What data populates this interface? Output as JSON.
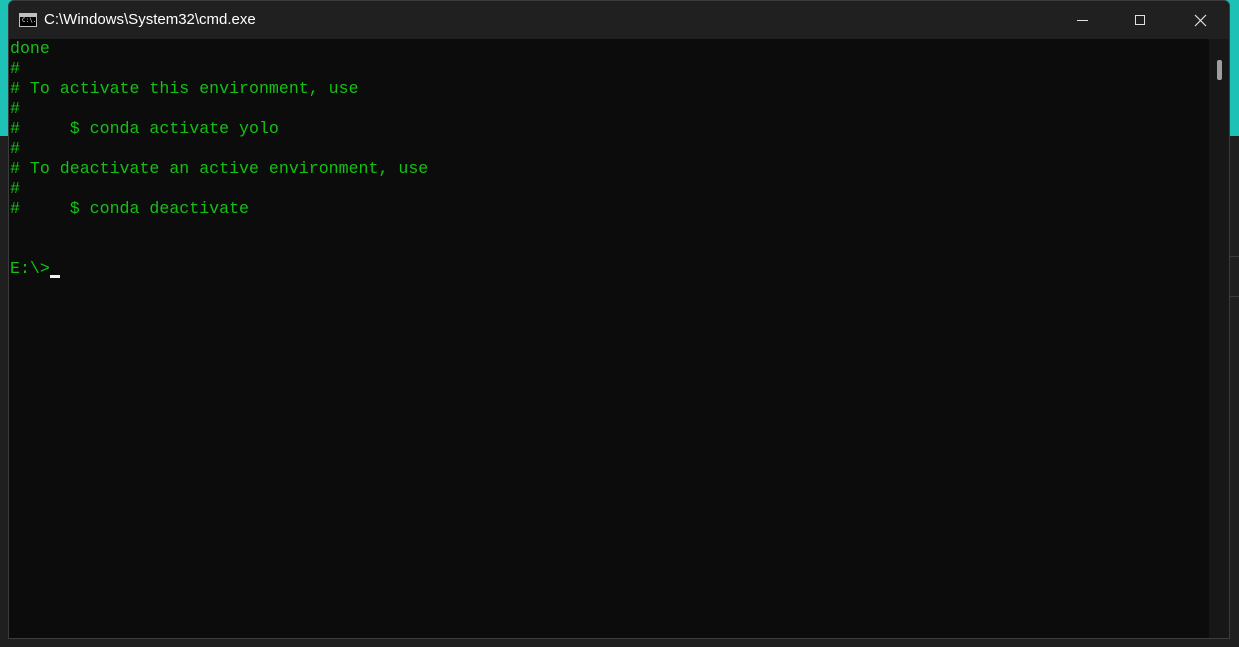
{
  "window": {
    "title": "C:\\Windows\\System32\\cmd.exe",
    "icon_label": "C:\\."
  },
  "console_lines": [
    "done",
    "#",
    "# To activate this environment, use",
    "#",
    "#     $ conda activate yolo",
    "#",
    "# To deactivate an active environment, use",
    "#",
    "#     $ conda deactivate",
    "",
    "",
    "E:\\>"
  ],
  "colors": {
    "console_text": "#13c113",
    "console_background": "#0c0c0c",
    "titlebar": "#202020",
    "desktop_accent": "#1ec1b5"
  },
  "icons": {
    "app": "cmd-icon",
    "minimize": "minimize-icon",
    "maximize": "maximize-icon",
    "close": "close-icon"
  }
}
